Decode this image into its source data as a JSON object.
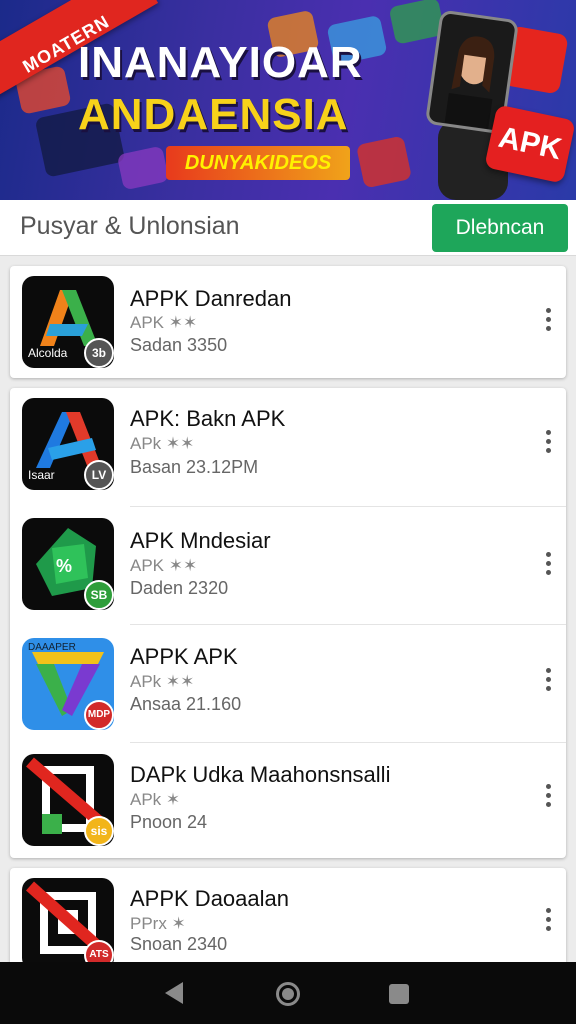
{
  "banner": {
    "ribbon_text": "MOATERN",
    "title_line1": "INANAYIOAR",
    "title_line2": "ANDAENSIA",
    "pill_text": "DUNYAKIDEOS",
    "apk_badge": "APK"
  },
  "header": {
    "title": "Pusyar & Unlonsian",
    "button_label": "Dlebncan"
  },
  "apps": [
    {
      "name": "APPK Danredan",
      "sub": "APK ✶✶",
      "meta": "Sadan 3350",
      "icon_label": "Alcolda",
      "badge_text": "3b",
      "badge_color": "#555555",
      "icon_theme": "green-orange-A"
    },
    {
      "name": "APK: Bakn APK",
      "sub": "APk ✶✶",
      "meta": "Basan 23.12PM",
      "icon_label": "Isaar",
      "badge_text": "LV",
      "badge_color": "#555555",
      "icon_theme": "blue-red-A"
    },
    {
      "name": "APK Mndesiar",
      "sub": "APK ✶✶",
      "meta": "Daden 2320",
      "icon_label": "",
      "badge_text": "SB",
      "badge_color": "#2e9e3a",
      "icon_theme": "green-star"
    },
    {
      "name": "APPK APK",
      "sub": "APk ✶✶",
      "meta": "Ansaa 21.160",
      "icon_label": "DAAAPER",
      "badge_text": "MDP",
      "badge_color": "#d22a2a",
      "icon_theme": "blue-V"
    },
    {
      "name": "DAPk Udka Maahonsnsalli",
      "sub": "APk ✶",
      "meta": "Pnoon 24",
      "icon_label": "",
      "badge_text": "sis",
      "badge_color": "#f2b51a",
      "icon_theme": "red-slash-A"
    },
    {
      "name": "APPK Daoaalan",
      "sub": "PPrx ✶",
      "meta": "Snoan 2340",
      "icon_label": "",
      "badge_text": "ATS",
      "badge_color": "#d22a2a",
      "icon_theme": "red-slash-box"
    }
  ],
  "navbar": {
    "icons": [
      "back-icon",
      "home-icon",
      "recent-apps-icon"
    ]
  }
}
